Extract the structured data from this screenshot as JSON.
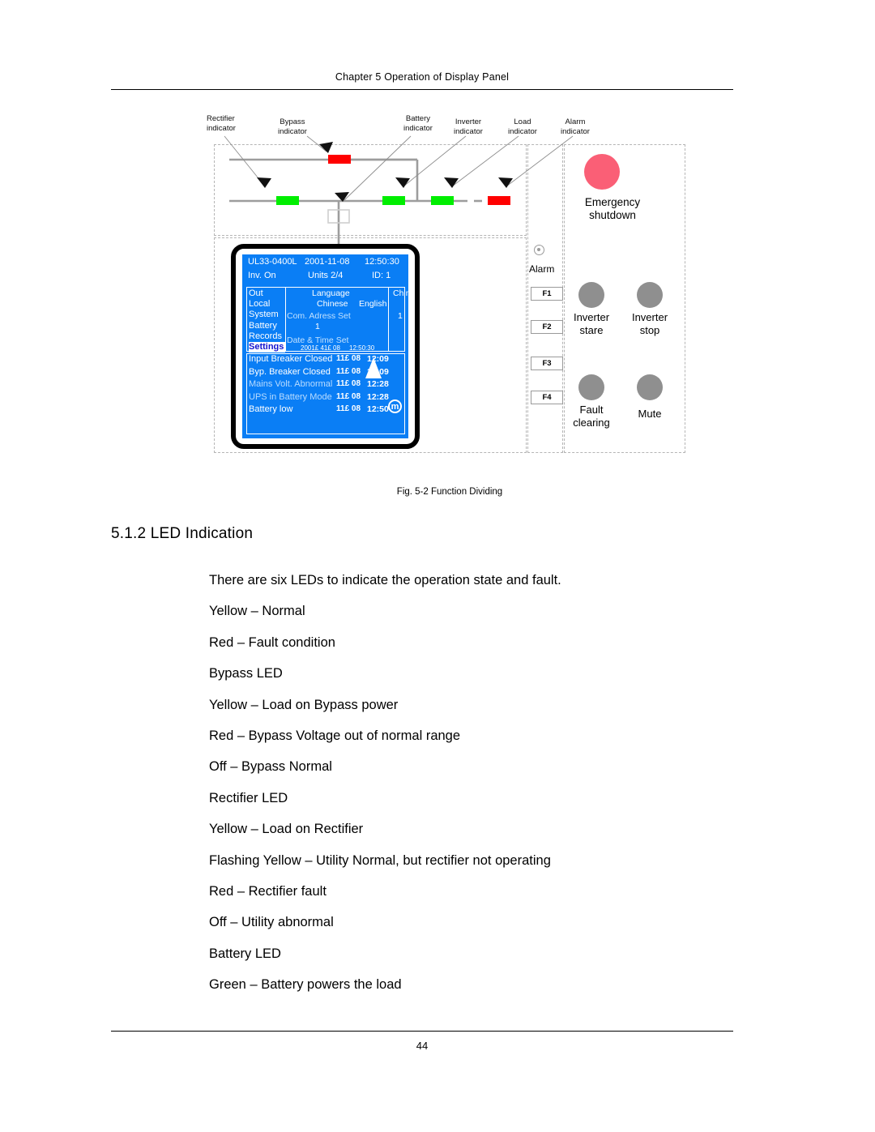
{
  "page": {
    "header": "Chapter 5  Operation of Display Panel",
    "number": "44"
  },
  "figure": {
    "caption": "Fig. 5-2  Function Dividing",
    "callouts": [
      {
        "line1": "Rectifier",
        "line2": "indicator"
      },
      {
        "line1": "Bypass",
        "line2": "indicator"
      },
      {
        "line1": "Battery",
        "line2": "indicator"
      },
      {
        "line1": "Inverter",
        "line2": "indicator"
      },
      {
        "line1": "Load",
        "line2": "indicator"
      },
      {
        "line1": "Alarm",
        "line2": "indicator"
      }
    ],
    "leds": [
      {
        "name": "bypass-led",
        "color": "#ff0000"
      },
      {
        "name": "rectifier-led",
        "color": "#00ee00"
      },
      {
        "name": "battery-led",
        "color": "#00ee00"
      },
      {
        "name": "inverter-led",
        "color": "#00ee00"
      },
      {
        "name": "load-led",
        "color": "#ff0000"
      }
    ],
    "lcd": {
      "status": {
        "model": "UL33-0400L",
        "date": "2001-11-08",
        "time": "12:50:30",
        "state": "Inv. On",
        "units": "Units  2/4",
        "id": "ID: 1"
      },
      "menu": [
        {
          "label": "Out",
          "selected": false
        },
        {
          "label": "Local",
          "selected": false
        },
        {
          "label": "System",
          "selected": false
        },
        {
          "label": "Battery",
          "selected": false
        },
        {
          "label": "Records",
          "selected": false
        },
        {
          "label": "Settings",
          "selected": true
        }
      ],
      "detail": {
        "language_label": "Language",
        "language_value": "Chinese",
        "language_option_1": "Chinese",
        "language_option_2": "English",
        "com_address_label": "Com. Adress Set",
        "com_address_value": "1",
        "com_address_value_2": "1",
        "datetime_label": "Date & Time Set",
        "datetime_date": "2001£ 41£ 08",
        "datetime_time": "12:50:30"
      },
      "log": [
        {
          "name": "Input Breaker Closed",
          "monthday": "11£ 08",
          "time": "12:09",
          "dim": false
        },
        {
          "name": "Byp. Breaker Closed",
          "monthday": "11£ 08",
          "time": "12:09",
          "dim": false
        },
        {
          "name": "Mains Volt. Abnormal",
          "monthday": "11£ 08",
          "time": "12:28",
          "dim": true
        },
        {
          "name": "UPS in Battery Mode",
          "monthday": "11£ 08",
          "time": "12:28",
          "dim": true
        },
        {
          "name": "Battery low",
          "monthday": "11£ 08",
          "time": "12:50",
          "dim": false
        }
      ],
      "mute_icon_glyph": "m"
    },
    "alarm_column": {
      "label": "Alarm",
      "fkeys": [
        "F1",
        "F2",
        "F3",
        "F4"
      ]
    },
    "control_column": {
      "emergency_shutdown": "Emergency\nshutdown",
      "emergency_shutdown_line1": "Emergency",
      "emergency_shutdown_line2": "shutdown",
      "emergency_color": "#fa5f76",
      "buttons": [
        {
          "line1": "Inverter",
          "line2": "stare"
        },
        {
          "line1": "Inverter",
          "line2": "stop"
        },
        {
          "line1": "Fault",
          "line2": "clearing"
        },
        {
          "line1": "Mute",
          "line2": ""
        }
      ]
    }
  },
  "section": {
    "heading": "5.1.2  LED Indication",
    "lines": [
      "There are six LEDs to indicate the operation state and fault.",
      "Yellow – Normal",
      "Red – Fault condition",
      "Bypass LED",
      "Yellow – Load on Bypass power",
      "Red – Bypass Voltage out of normal range",
      "Off – Bypass Normal",
      "Rectifier LED",
      "Yellow – Load on Rectifier",
      "Flashing Yellow – Utility Normal, but rectifier not operating",
      "Red – Rectifier fault",
      "Off – Utility abnormal",
      "Battery LED",
      "Green – Battery powers the load"
    ]
  }
}
